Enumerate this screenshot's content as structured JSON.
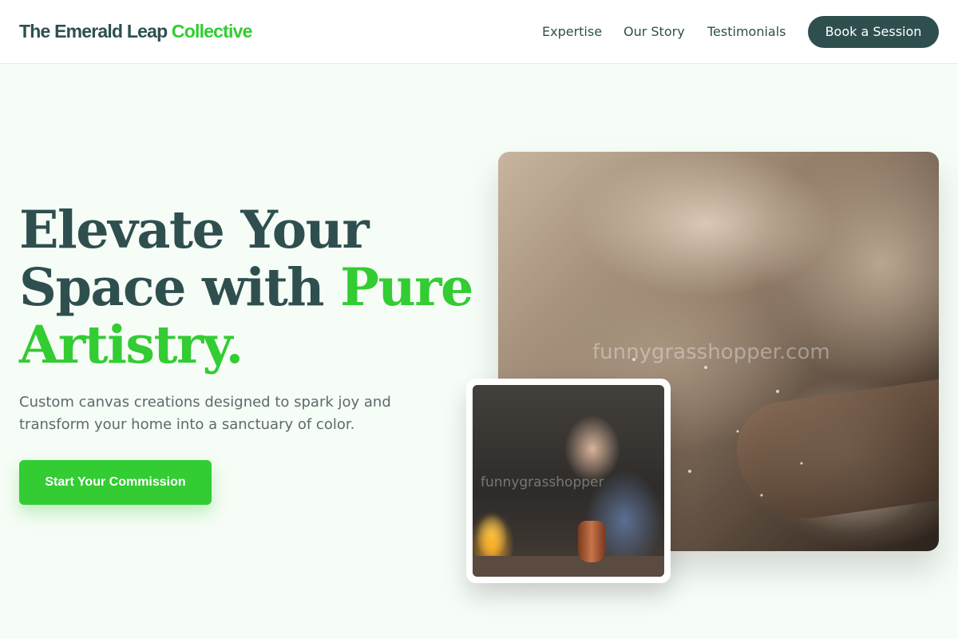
{
  "nav": {
    "brand_primary": "The Emerald Leap",
    "brand_accent": "Collective",
    "links": [
      {
        "label": "Expertise"
      },
      {
        "label": "Our Story"
      },
      {
        "label": "Testimonials"
      }
    ],
    "cta_label": "Book a Session"
  },
  "hero": {
    "headline_line1": "Elevate Your",
    "headline_line2": "Space with",
    "headline_accent1": "Pure",
    "headline_accent2": "Artistry.",
    "subtext": "Custom canvas creations designed to spark joy and transform your home into a sanctuary of color.",
    "cta_label": "Start Your Commission"
  },
  "images": {
    "watermark_main": "funnygrasshopper.com",
    "watermark_small": "funnygrasshopper"
  },
  "colors": {
    "brand_dark": "#2f4f4f",
    "brand_green": "#33cc33",
    "background": "#f6fcf6"
  }
}
